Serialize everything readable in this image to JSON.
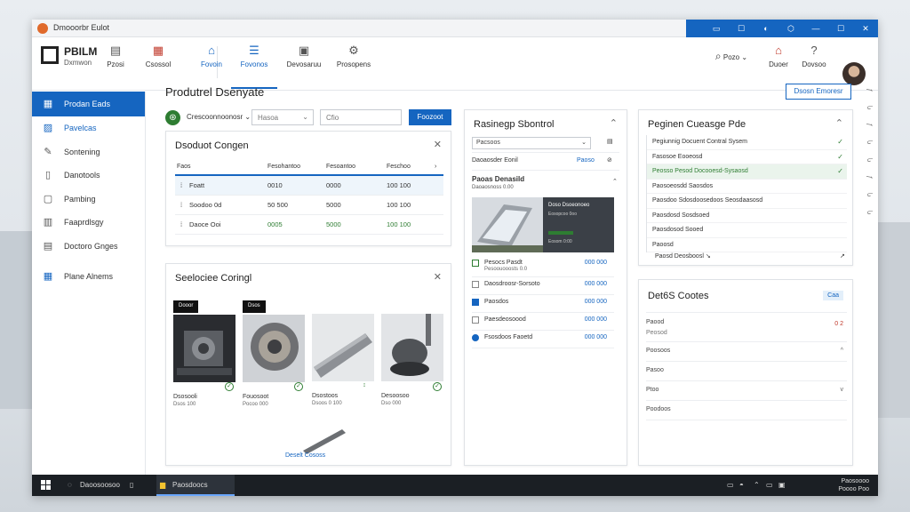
{
  "window": {
    "title": "Dmooorbr Eulot"
  },
  "titlebar_controls": [
    "▭",
    "☐",
    "◐",
    "⬡",
    "—",
    "☐",
    "✕"
  ],
  "ribbon": {
    "logo_text": "PBILM",
    "logo_sub": "Dxmwon",
    "tools": [
      {
        "label": "Pzosi",
        "icon": "document-icon"
      },
      {
        "label": "Csossol",
        "icon": "grid-icon"
      },
      {
        "label": "Fovoin",
        "icon": "home-icon"
      },
      {
        "label": "Fovonos",
        "icon": "list-icon"
      },
      {
        "label": "Devosaruu",
        "icon": "monitor-icon"
      },
      {
        "label": "Prosopens",
        "icon": "settings-icon"
      }
    ],
    "right_tools": [
      {
        "label": "Pozo",
        "icon": "search-icon"
      },
      {
        "label": "Duoer",
        "icon": "home-icon"
      },
      {
        "label": "Dovsoo",
        "icon": "help-icon"
      }
    ]
  },
  "sidebar": {
    "items": [
      {
        "label": "Prodan Eads",
        "icon": "grid-icon",
        "active": true
      },
      {
        "label": "Pavelcas",
        "icon": "image-icon"
      },
      {
        "label": "Sontening",
        "icon": "wrench-icon"
      },
      {
        "label": "Danotools",
        "icon": "document-icon"
      },
      {
        "label": "Pambing",
        "icon": "box-icon"
      },
      {
        "label": "Faaprdlsgy",
        "icon": "chart-icon"
      },
      {
        "label": "Doctoro Gnges",
        "icon": "file-icon"
      },
      {
        "label": "Plane Alnems",
        "icon": "calendar-icon"
      }
    ]
  },
  "main": {
    "title": "Produtrel Dsenyate",
    "export_label": "Dsosn Emoresr",
    "filter": {
      "label": "Crescoonnoonosr",
      "input1": "Hasoa",
      "input2": "Cfio",
      "apply_label": "Foozoot"
    }
  },
  "scrollbar_labels": [
    "ƒ",
    "Ⴑ",
    "ƒ",
    "Ⴑ",
    "Ⴑ",
    "ƒ",
    "Ⴑ",
    "Ⴑ"
  ],
  "product_card": {
    "title": "Dsoduot Congen",
    "headers": [
      "Faos",
      "Fesohantoo",
      "Fesoantoo",
      "Feschoo"
    ],
    "rows": [
      {
        "a": "Foatt",
        "b": "0010",
        "c": "0000",
        "d": "100 100",
        "green": false
      },
      {
        "a": "Soodoo 0d",
        "b": "50 500",
        "c": "5000",
        "d": "100 100",
        "green": false
      },
      {
        "a": "Daoce Ooi",
        "b": "0005",
        "c": "5000",
        "d": "100 100",
        "green": true
      }
    ]
  },
  "components_card": {
    "title": "Seelociee Coringl",
    "items": [
      {
        "tag": "Dooor",
        "name": "Dsosooli",
        "sub": "Dsos 100",
        "check": "✓"
      },
      {
        "tag": "Dsos",
        "name": "Fouosoot",
        "sub": "Pocoo 000",
        "check": "✓"
      },
      {
        "tag": "",
        "name": "Dsostoos",
        "sub": "Dsoos 0 100",
        "check": ""
      },
      {
        "tag": "",
        "name": "Desoosoo",
        "sub": "Dso 000",
        "check": "✓"
      }
    ],
    "link": "Deselt Cososs"
  },
  "version_card": {
    "title": "Rasinegp Sbontrol",
    "select": "Pacsoos",
    "row_label": "Daoaosder Eonil",
    "row_link": "Paoso",
    "section_title": "Paoas Denasild",
    "section_sub": "Daoaosnoss 0.00",
    "preview": {
      "heading": "Doso Dsoeonoeo",
      "line1": "Eosopcoo 0oo",
      "line2": "Eosom 0:00"
    },
    "items": [
      {
        "name": "Pesocs Pasdt",
        "sub": "Pesoouooosts 0.0",
        "value": "000 000"
      },
      {
        "name": "Daosdroosr-Sorsoto",
        "sub": "",
        "value": "000 000"
      },
      {
        "name": "Paosdos",
        "sub": "",
        "value": "000 000"
      },
      {
        "name": "Paesdeosoood",
        "sub": "",
        "value": "000 000"
      },
      {
        "name": "Fsosdoos Faoetd",
        "sub": "",
        "value": "000 000"
      }
    ]
  },
  "approval_card": {
    "title": "Peginen Cueasge Pde",
    "items": [
      {
        "label": "Pegiunnig Docuent Contral Sysem",
        "check": "✓",
        "hl": false
      },
      {
        "label": "Fasosoe Eooeosd",
        "check": "✓",
        "hl": false
      },
      {
        "label": "Peosso Pesod Docooesd-Sysaosd",
        "check": "✓",
        "hl": true
      },
      {
        "label": "Paosoeosdd Saosdos",
        "check": "",
        "hl": false
      },
      {
        "label": "Paosdoo Sdosdoosedoos Seosdaasosd",
        "check": "",
        "hl": false
      },
      {
        "label": "Paosdosd Sosdsoed",
        "check": "",
        "hl": false
      },
      {
        "label": "Paosdosod Sooed",
        "check": "",
        "hl": false
      },
      {
        "label": "Paoosd",
        "check": "",
        "hl": false
      }
    ],
    "footer": "Paosd Deosboosl ↘"
  },
  "details_card": {
    "title": "Det6S Cootes",
    "badge": "Caa",
    "rows": [
      {
        "label": "Paood",
        "sub": "Peosod",
        "value": "0 2"
      },
      {
        "label": "Poosoos",
        "sub": "",
        "value": "^"
      },
      {
        "label": "Pasoo",
        "sub": "",
        "value": ""
      },
      {
        "label": "Ptoo",
        "sub": "",
        "value": "v"
      },
      {
        "label": "Poodoos",
        "sub": "",
        "value": ""
      }
    ]
  },
  "taskbar": {
    "search": "Daoosoosoo",
    "app": "Paosdoocs",
    "tray_line1": "Paosoooo",
    "tray_line2": "Poooo Poo"
  }
}
